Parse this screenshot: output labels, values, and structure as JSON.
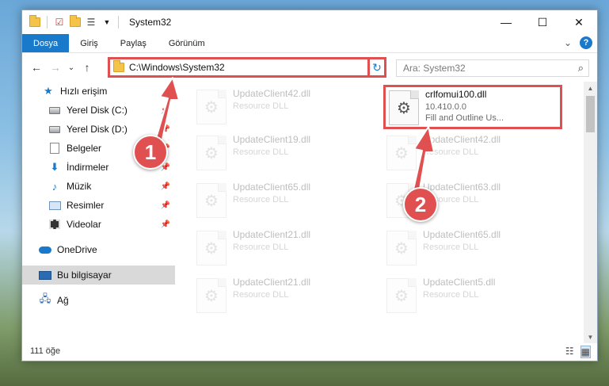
{
  "window": {
    "title": "System32",
    "controls": {
      "minimize": "—",
      "maximize": "☐",
      "close": "✕"
    }
  },
  "ribbon": {
    "tabs": [
      {
        "label": "Dosya",
        "active": true
      },
      {
        "label": "Giriş"
      },
      {
        "label": "Paylaş"
      },
      {
        "label": "Görünüm"
      }
    ],
    "expand_glyph": "⌄",
    "help_glyph": "?"
  },
  "nav": {
    "back": "←",
    "forward": "→",
    "recent": "⌄",
    "up": "↑",
    "address": "C:\\Windows\\System32",
    "address_dropdown": "⌄",
    "refresh_glyph": "↻",
    "search_placeholder": "Ara: System32",
    "search_icon_glyph": "⌕"
  },
  "sidebar": {
    "quick_access": "Hızlı erişim",
    "items": [
      {
        "label": "Yerel Disk (C:)",
        "icon": "drive-icon"
      },
      {
        "label": "Yerel Disk (D:)",
        "icon": "drive-icon"
      },
      {
        "label": "Belgeler",
        "icon": "documents-icon"
      },
      {
        "label": "İndirmeler",
        "icon": "download-icon"
      },
      {
        "label": "Müzik",
        "icon": "music-icon"
      },
      {
        "label": "Resimler",
        "icon": "pictures-icon"
      },
      {
        "label": "Videolar",
        "icon": "videos-icon"
      }
    ],
    "onedrive": "OneDrive",
    "this_pc": "Bu bilgisayar",
    "network": "Ağ"
  },
  "files": {
    "left_column": [
      {
        "name": "UpdateClient42.dll",
        "type": "Resource DLL"
      },
      {
        "name": "UpdateClient19.dll",
        "type": "Resource DLL"
      },
      {
        "name": "UpdateClient65.dll",
        "type": "Resource DLL"
      },
      {
        "name": "UpdateClient21.dll",
        "type": "Resource DLL"
      },
      {
        "name": "UpdateClient21.dll",
        "type": "Resource DLL"
      }
    ],
    "right_column": [
      {
        "name": "crlfomui100.dll",
        "version": "10.410.0.0",
        "desc": "Fill and Outline Us..."
      },
      {
        "name": "UpdateClient42.dll",
        "type": "Resource DLL"
      },
      {
        "name": "UpdateClient63.dll",
        "type": "Resource DLL"
      },
      {
        "name": "UpdateClient65.dll",
        "type": "Resource DLL"
      },
      {
        "name": "UpdateClient5.dll",
        "type": "Resource DLL"
      }
    ]
  },
  "status": {
    "count": "111 öğe"
  },
  "callouts": {
    "one": "1",
    "two": "2"
  },
  "colors": {
    "accent": "#1979ca",
    "callout": "#e05050"
  }
}
